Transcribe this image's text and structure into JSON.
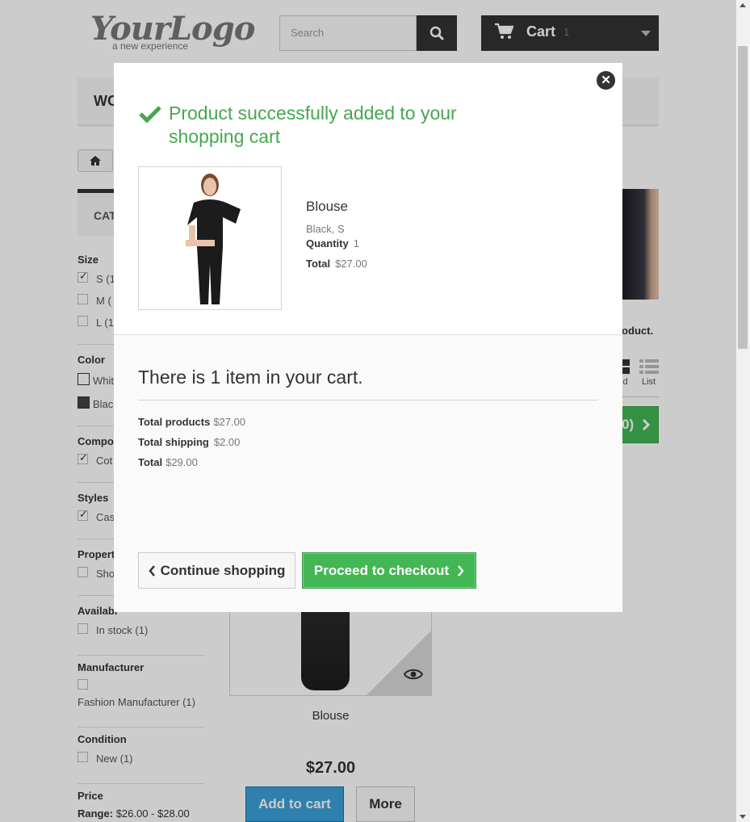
{
  "header": {
    "logo_main": "YourLogo",
    "logo_sub": "a new experience",
    "search_placeholder": "Search",
    "cart_label": "Cart",
    "cart_qty": "1"
  },
  "menu": {
    "first_item": "WO"
  },
  "sidebar": {
    "categories_label": "CAT",
    "filters": {
      "size": {
        "title": "Size",
        "options": [
          "S (1",
          "M (",
          "L (1"
        ]
      },
      "color": {
        "title": "Color",
        "options": [
          "Whit",
          "Blac"
        ]
      },
      "composition": {
        "title": "Compos",
        "options": [
          "Cot"
        ]
      },
      "styles": {
        "title": "Styles",
        "options": [
          "Cas"
        ]
      },
      "properties": {
        "title": "Properti",
        "options": [
          "Sho"
        ]
      },
      "availability": {
        "title": "Availabi",
        "options": [
          "In stock (1)"
        ]
      },
      "manufacturer": {
        "title": "Manufacturer",
        "options": [
          "Fashion Manufacturer (1)"
        ]
      },
      "condition": {
        "title": "Condition",
        "options": [
          "New (1)"
        ]
      },
      "price": {
        "title": "Price",
        "range_label": "Range:",
        "range_value": "$26.00 - $28.00"
      }
    }
  },
  "main": {
    "banner_text": "roduct.",
    "view_grid_label": "id",
    "view_list_label": "List",
    "compare_label": "0)",
    "product_name": "Blouse",
    "product_price": "$27.00",
    "add_to_cart": "Add to cart",
    "more": "More"
  },
  "modal": {
    "success_title": "Product successfully added to your shopping cart",
    "product_name": "Blouse",
    "product_attributes": "Black, S",
    "quantity_label": "Quantity",
    "quantity_value": "1",
    "total_label": "Total",
    "total_value": "$27.00",
    "cart_count_text": "There is 1 item in your cart.",
    "total_products_label": "Total products",
    "total_products_value": "$27.00",
    "total_shipping_label": "Total shipping",
    "total_shipping_value": "$2.00",
    "grand_total_label": "Total",
    "grand_total_value": "$29.00",
    "continue_label": "Continue shopping",
    "checkout_label": "Proceed to checkout"
  },
  "colors": {
    "success": "#46a74e",
    "checkout_bg": "#43b754",
    "dark": "#333333",
    "add_to_cart_bg": "#3da0d9"
  }
}
